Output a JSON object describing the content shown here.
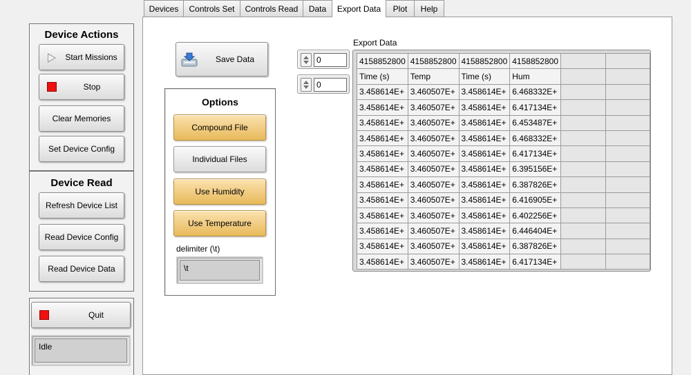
{
  "tabs": [
    {
      "label": "Devices",
      "active": false
    },
    {
      "label": "Controls Set",
      "active": false
    },
    {
      "label": "Controls Read",
      "active": false
    },
    {
      "label": "Data",
      "active": false
    },
    {
      "label": "Export Data",
      "active": true
    },
    {
      "label": "Plot",
      "active": false
    },
    {
      "label": "Help",
      "active": false
    }
  ],
  "device_actions": {
    "title": "Device Actions",
    "start_missions": "Start Missions",
    "stop": "Stop",
    "clear_memories": "Clear Memories",
    "set_device_config": "Set Device Config"
  },
  "device_read": {
    "title": "Device Read",
    "refresh_device_list": "Refresh Device List",
    "read_device_config": "Read Device Config",
    "read_device_data": "Read Device Data"
  },
  "quit_label": "Quit",
  "status_text": "Idle",
  "save_data_label": "Save Data",
  "options": {
    "title": "Options",
    "compound_file": {
      "label": "Compound File",
      "on": true
    },
    "individual_files": {
      "label": "Individual Files",
      "on": false
    },
    "use_humidity": {
      "label": "Use Humidity",
      "on": true
    },
    "use_temperature": {
      "label": "Use Temperature",
      "on": true
    },
    "delimiter_label": "delimiter (\\t)",
    "delimiter_value": "\\t"
  },
  "spinners": {
    "row_index": "0",
    "col_index": "0"
  },
  "export": {
    "label": "Export Data",
    "rows": [
      [
        "4158852800",
        "4158852800",
        "4158852800",
        "4158852800",
        "",
        ""
      ],
      [
        "Time (s)",
        "Temp",
        "Time (s)",
        "Hum",
        "",
        ""
      ],
      [
        "3.458614E+",
        "3.460507E+",
        "3.458614E+",
        "6.468332E+",
        "",
        ""
      ],
      [
        "3.458614E+",
        "3.460507E+",
        "3.458614E+",
        "6.417134E+",
        "",
        ""
      ],
      [
        "3.458614E+",
        "3.460507E+",
        "3.458614E+",
        "6.453487E+",
        "",
        ""
      ],
      [
        "3.458614E+",
        "3.460507E+",
        "3.458614E+",
        "6.468332E+",
        "",
        ""
      ],
      [
        "3.458614E+",
        "3.460507E+",
        "3.458614E+",
        "6.417134E+",
        "",
        ""
      ],
      [
        "3.458614E+",
        "3.460507E+",
        "3.458614E+",
        "6.395156E+",
        "",
        ""
      ],
      [
        "3.458614E+",
        "3.460507E+",
        "3.458614E+",
        "6.387826E+",
        "",
        ""
      ],
      [
        "3.458614E+",
        "3.460507E+",
        "3.458614E+",
        "6.416905E+",
        "",
        ""
      ],
      [
        "3.458614E+",
        "3.460507E+",
        "3.458614E+",
        "6.402256E+",
        "",
        ""
      ],
      [
        "3.458614E+",
        "3.460507E+",
        "3.458614E+",
        "6.446404E+",
        "",
        ""
      ],
      [
        "3.458614E+",
        "3.460507E+",
        "3.458614E+",
        "6.387826E+",
        "",
        ""
      ],
      [
        "3.458614E+",
        "3.460507E+",
        "3.458614E+",
        "6.417134E+",
        "",
        ""
      ]
    ]
  },
  "colors": {
    "option_on": "#e8b95a",
    "stop_indicator": "#ee1111"
  }
}
